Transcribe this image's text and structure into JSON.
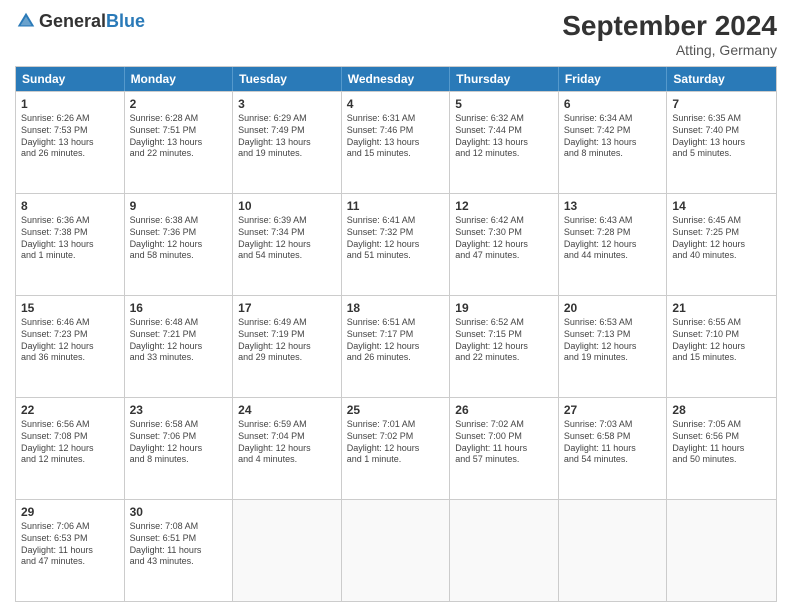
{
  "header": {
    "logo_general": "General",
    "logo_blue": "Blue",
    "month": "September 2024",
    "location": "Atting, Germany"
  },
  "weekdays": [
    "Sunday",
    "Monday",
    "Tuesday",
    "Wednesday",
    "Thursday",
    "Friday",
    "Saturday"
  ],
  "rows": [
    [
      {
        "day": "1",
        "lines": [
          "Sunrise: 6:26 AM",
          "Sunset: 7:53 PM",
          "Daylight: 13 hours",
          "and 26 minutes."
        ]
      },
      {
        "day": "2",
        "lines": [
          "Sunrise: 6:28 AM",
          "Sunset: 7:51 PM",
          "Daylight: 13 hours",
          "and 22 minutes."
        ]
      },
      {
        "day": "3",
        "lines": [
          "Sunrise: 6:29 AM",
          "Sunset: 7:49 PM",
          "Daylight: 13 hours",
          "and 19 minutes."
        ]
      },
      {
        "day": "4",
        "lines": [
          "Sunrise: 6:31 AM",
          "Sunset: 7:46 PM",
          "Daylight: 13 hours",
          "and 15 minutes."
        ]
      },
      {
        "day": "5",
        "lines": [
          "Sunrise: 6:32 AM",
          "Sunset: 7:44 PM",
          "Daylight: 13 hours",
          "and 12 minutes."
        ]
      },
      {
        "day": "6",
        "lines": [
          "Sunrise: 6:34 AM",
          "Sunset: 7:42 PM",
          "Daylight: 13 hours",
          "and 8 minutes."
        ]
      },
      {
        "day": "7",
        "lines": [
          "Sunrise: 6:35 AM",
          "Sunset: 7:40 PM",
          "Daylight: 13 hours",
          "and 5 minutes."
        ]
      }
    ],
    [
      {
        "day": "8",
        "lines": [
          "Sunrise: 6:36 AM",
          "Sunset: 7:38 PM",
          "Daylight: 13 hours",
          "and 1 minute."
        ]
      },
      {
        "day": "9",
        "lines": [
          "Sunrise: 6:38 AM",
          "Sunset: 7:36 PM",
          "Daylight: 12 hours",
          "and 58 minutes."
        ]
      },
      {
        "day": "10",
        "lines": [
          "Sunrise: 6:39 AM",
          "Sunset: 7:34 PM",
          "Daylight: 12 hours",
          "and 54 minutes."
        ]
      },
      {
        "day": "11",
        "lines": [
          "Sunrise: 6:41 AM",
          "Sunset: 7:32 PM",
          "Daylight: 12 hours",
          "and 51 minutes."
        ]
      },
      {
        "day": "12",
        "lines": [
          "Sunrise: 6:42 AM",
          "Sunset: 7:30 PM",
          "Daylight: 12 hours",
          "and 47 minutes."
        ]
      },
      {
        "day": "13",
        "lines": [
          "Sunrise: 6:43 AM",
          "Sunset: 7:28 PM",
          "Daylight: 12 hours",
          "and 44 minutes."
        ]
      },
      {
        "day": "14",
        "lines": [
          "Sunrise: 6:45 AM",
          "Sunset: 7:25 PM",
          "Daylight: 12 hours",
          "and 40 minutes."
        ]
      }
    ],
    [
      {
        "day": "15",
        "lines": [
          "Sunrise: 6:46 AM",
          "Sunset: 7:23 PM",
          "Daylight: 12 hours",
          "and 36 minutes."
        ]
      },
      {
        "day": "16",
        "lines": [
          "Sunrise: 6:48 AM",
          "Sunset: 7:21 PM",
          "Daylight: 12 hours",
          "and 33 minutes."
        ]
      },
      {
        "day": "17",
        "lines": [
          "Sunrise: 6:49 AM",
          "Sunset: 7:19 PM",
          "Daylight: 12 hours",
          "and 29 minutes."
        ]
      },
      {
        "day": "18",
        "lines": [
          "Sunrise: 6:51 AM",
          "Sunset: 7:17 PM",
          "Daylight: 12 hours",
          "and 26 minutes."
        ]
      },
      {
        "day": "19",
        "lines": [
          "Sunrise: 6:52 AM",
          "Sunset: 7:15 PM",
          "Daylight: 12 hours",
          "and 22 minutes."
        ]
      },
      {
        "day": "20",
        "lines": [
          "Sunrise: 6:53 AM",
          "Sunset: 7:13 PM",
          "Daylight: 12 hours",
          "and 19 minutes."
        ]
      },
      {
        "day": "21",
        "lines": [
          "Sunrise: 6:55 AM",
          "Sunset: 7:10 PM",
          "Daylight: 12 hours",
          "and 15 minutes."
        ]
      }
    ],
    [
      {
        "day": "22",
        "lines": [
          "Sunrise: 6:56 AM",
          "Sunset: 7:08 PM",
          "Daylight: 12 hours",
          "and 12 minutes."
        ]
      },
      {
        "day": "23",
        "lines": [
          "Sunrise: 6:58 AM",
          "Sunset: 7:06 PM",
          "Daylight: 12 hours",
          "and 8 minutes."
        ]
      },
      {
        "day": "24",
        "lines": [
          "Sunrise: 6:59 AM",
          "Sunset: 7:04 PM",
          "Daylight: 12 hours",
          "and 4 minutes."
        ]
      },
      {
        "day": "25",
        "lines": [
          "Sunrise: 7:01 AM",
          "Sunset: 7:02 PM",
          "Daylight: 12 hours",
          "and 1 minute."
        ]
      },
      {
        "day": "26",
        "lines": [
          "Sunrise: 7:02 AM",
          "Sunset: 7:00 PM",
          "Daylight: 11 hours",
          "and 57 minutes."
        ]
      },
      {
        "day": "27",
        "lines": [
          "Sunrise: 7:03 AM",
          "Sunset: 6:58 PM",
          "Daylight: 11 hours",
          "and 54 minutes."
        ]
      },
      {
        "day": "28",
        "lines": [
          "Sunrise: 7:05 AM",
          "Sunset: 6:56 PM",
          "Daylight: 11 hours",
          "and 50 minutes."
        ]
      }
    ],
    [
      {
        "day": "29",
        "lines": [
          "Sunrise: 7:06 AM",
          "Sunset: 6:53 PM",
          "Daylight: 11 hours",
          "and 47 minutes."
        ]
      },
      {
        "day": "30",
        "lines": [
          "Sunrise: 7:08 AM",
          "Sunset: 6:51 PM",
          "Daylight: 11 hours",
          "and 43 minutes."
        ]
      },
      {
        "day": "",
        "lines": []
      },
      {
        "day": "",
        "lines": []
      },
      {
        "day": "",
        "lines": []
      },
      {
        "day": "",
        "lines": []
      },
      {
        "day": "",
        "lines": []
      }
    ]
  ]
}
